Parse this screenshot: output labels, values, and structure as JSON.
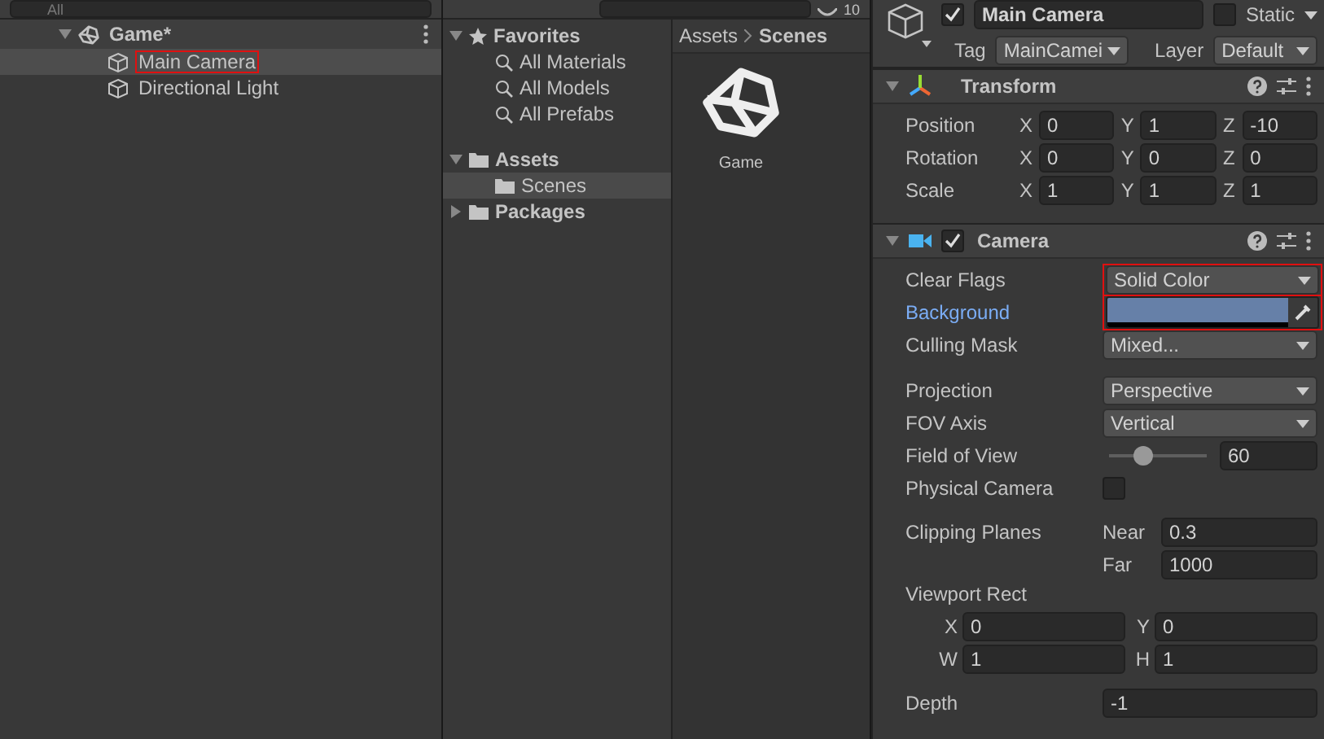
{
  "hierarchy": {
    "search": {
      "placeholder": "All"
    },
    "scene": {
      "name": "Game*",
      "expanded": true,
      "children": [
        {
          "name": "Main Camera",
          "selected": true,
          "highlighted": true
        },
        {
          "name": "Directional Light",
          "selected": false,
          "highlighted": false
        }
      ]
    }
  },
  "project": {
    "hidden_count": "10",
    "tree": [
      {
        "label": "Favorites",
        "kind": "favorites",
        "expanded": true,
        "selected": false,
        "children": [
          {
            "label": "All Materials",
            "kind": "search",
            "selected": false
          },
          {
            "label": "All Models",
            "kind": "search",
            "selected": false
          },
          {
            "label": "All Prefabs",
            "kind": "search",
            "selected": false
          }
        ]
      },
      {
        "label": "Assets",
        "kind": "folder",
        "expanded": true,
        "selected": false,
        "children": [
          {
            "label": "Scenes",
            "kind": "folder",
            "selected": true
          }
        ]
      },
      {
        "label": "Packages",
        "kind": "folder",
        "expanded": false,
        "selected": false
      }
    ],
    "breadcrumb": [
      "Assets",
      "Scenes"
    ],
    "items": [
      {
        "label": "Game",
        "kind": "scene"
      }
    ]
  },
  "inspector": {
    "active": true,
    "name": "Main Camera",
    "static": false,
    "static_label": "Static",
    "tag_label": "Tag",
    "tag": "MainCamei",
    "layer_label": "Layer",
    "layer": "Default",
    "transform": {
      "title": "Transform",
      "expanded": true,
      "rows": [
        {
          "label": "Position",
          "values": [
            {
              "axis": "X",
              "value": "0"
            },
            {
              "axis": "Y",
              "value": "1"
            },
            {
              "axis": "Z",
              "value": "-10"
            }
          ]
        },
        {
          "label": "Rotation",
          "values": [
            {
              "axis": "X",
              "value": "0"
            },
            {
              "axis": "Y",
              "value": "0"
            },
            {
              "axis": "Z",
              "value": "0"
            }
          ]
        },
        {
          "label": "Scale",
          "values": [
            {
              "axis": "X",
              "value": "1"
            },
            {
              "axis": "Y",
              "value": "1"
            },
            {
              "axis": "Z",
              "value": "1"
            }
          ]
        }
      ]
    },
    "camera": {
      "title": "Camera",
      "expanded": true,
      "enabled": true,
      "sections": [
        [
          {
            "kind": "dropdown",
            "label": "Clear Flags",
            "value": "Solid Color",
            "highlighted": true,
            "changed": false
          },
          {
            "kind": "color",
            "label": "Background",
            "color": "#6680a8",
            "highlighted": true,
            "changed": true
          },
          {
            "kind": "dropdown",
            "label": "Culling Mask",
            "value": "Mixed...",
            "highlighted": false,
            "changed": false
          }
        ],
        [
          {
            "kind": "dropdown",
            "label": "Projection",
            "value": "Perspective",
            "highlighted": false,
            "changed": false
          },
          {
            "kind": "dropdown",
            "label": "FOV Axis",
            "value": "Vertical",
            "highlighted": false,
            "changed": false
          },
          {
            "kind": "slider",
            "label": "Field of View",
            "level": 0.35,
            "value": "60",
            "highlighted": false,
            "changed": false
          },
          {
            "kind": "checkbox",
            "label": "Physical Camera",
            "checked": false,
            "highlighted": false,
            "changed": false
          }
        ],
        [
          {
            "kind": "nearfar",
            "label": "Clipping Planes",
            "near_label": "Near",
            "near": "0.3",
            "far_label": "Far",
            "far": "1000",
            "highlighted": false,
            "changed": false
          },
          {
            "kind": "rect",
            "label": "Viewport Rect",
            "rows": [
              [
                {
                  "axis": "X",
                  "value": "0"
                },
                {
                  "axis": "Y",
                  "value": "0"
                }
              ],
              [
                {
                  "axis": "W",
                  "value": "1"
                },
                {
                  "axis": "H",
                  "value": "1"
                }
              ]
            ],
            "highlighted": false,
            "changed": false
          }
        ],
        [
          {
            "kind": "number",
            "label": "Depth",
            "value": "-1",
            "highlighted": false,
            "changed": false
          }
        ]
      ]
    }
  }
}
